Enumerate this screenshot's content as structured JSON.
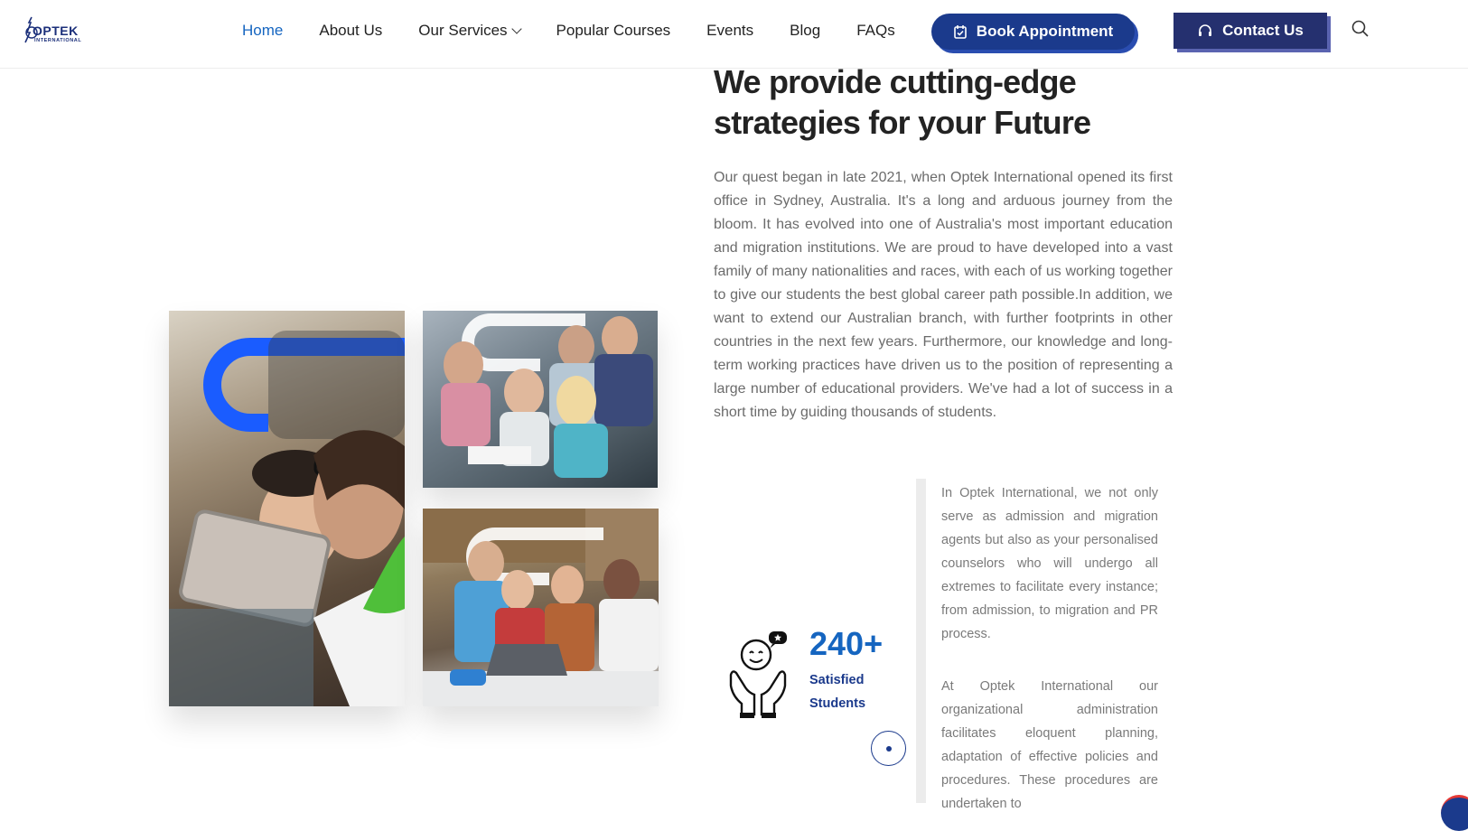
{
  "brand": {
    "name": "OPTEK",
    "sub": "INTERNATIONAL"
  },
  "nav": {
    "items": [
      {
        "label": "Home"
      },
      {
        "label": "About Us"
      },
      {
        "label": "Our Services"
      },
      {
        "label": "Popular Courses"
      },
      {
        "label": "Events"
      },
      {
        "label": "Blog"
      },
      {
        "label": "FAQs"
      }
    ],
    "active": "Home"
  },
  "header": {
    "book_label": "Book Appointment",
    "contact_label": "Contact Us"
  },
  "icons": {
    "search": "search-icon",
    "book": "calendar-check-icon",
    "contact": "headset-icon",
    "stat": "happy-hands-icon"
  },
  "colors": {
    "primary": "#1b3a8c",
    "accent": "#1565c0",
    "dark_button": "#25306f"
  },
  "main": {
    "headline": "We provide cutting-edge strategies for your Future",
    "intro": "Our quest began in late 2021, when Optek International opened its first office in Sydney, Australia. It's a long and arduous journey from the bloom. It has evolved into one of Australia's most important education and migration institutions. We are proud to have developed into a vast family of many nationalities and races, with each of us working together to give our students the best global career path possible.In addition, we want to extend our Australian branch, with further footprints in other countries in the next few years. Furthermore, our knowledge and long-term working practices have driven us to the position of representing a large number of educational providers. We've had a lot of success in a short time by guiding thousands of students."
  },
  "stats": {
    "value": "240+",
    "label": "Satisfied Students"
  },
  "side": {
    "p1": "In Optek International, we not only serve as admission and migration agents but also as your personalised counselors who will undergo all extremes to facilitate every instance; from admission, to migration and PR process.",
    "p2": "At Optek International our organizational administration facilitates eloquent planning, adaptation of effective policies and procedures. These procedures are undertaken to"
  }
}
